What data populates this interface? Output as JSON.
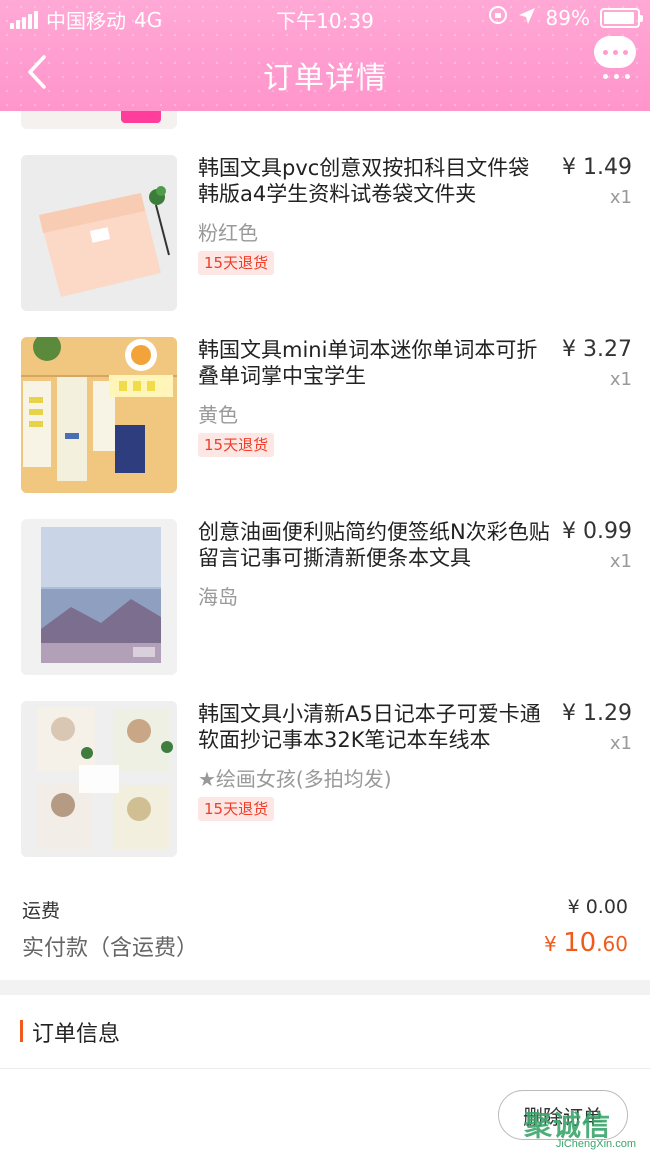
{
  "status_bar": {
    "carrier": "中国移动",
    "network": "4G",
    "time": "下午10:39",
    "battery": "89%"
  },
  "nav": {
    "title": "订单详情",
    "back_icon": "chevron-left-icon",
    "more_icon": "chat-more-icon"
  },
  "products": [
    {
      "name": "韩国文具pvc创意双按扣科目文件袋 韩版a4学生资料试卷袋文件夹",
      "spec": "粉红色",
      "tag": "15天退货",
      "price": "¥ 1.49",
      "qty": "x1"
    },
    {
      "name": "韩国文具mini单词本迷你单词本可折叠单词掌中宝学生",
      "spec": "黄色",
      "tag": "15天退货",
      "price": "¥ 3.27",
      "qty": "x1"
    },
    {
      "name": "创意油画便利贴简约便签纸N次彩色贴留言记事可撕清新便条本文具",
      "spec": "海岛",
      "tag": "",
      "price": "¥ 0.99",
      "qty": "x1"
    },
    {
      "name": "韩国文具小清新A5日记本子可爱卡通软面抄记事本32K笔记本车线本",
      "spec": "★绘画女孩(多拍均发)",
      "tag": "15天退货",
      "price": "¥ 1.29",
      "qty": "x1"
    }
  ],
  "totals": {
    "shipping_label": "运费",
    "shipping_value": "¥ 0.00",
    "paid_label": "实付款（含运费）",
    "paid_currency": "¥ ",
    "paid_integer": "10",
    "paid_decimal": ".60"
  },
  "order_info": {
    "heading": "订单信息"
  },
  "actions": {
    "delete_label": "删除订单"
  },
  "watermark": {
    "text": "聚诚信",
    "sub": "JiChengXin.com"
  },
  "colors": {
    "header_pink": "#ff9ccf",
    "accent_orange": "#f05a1a",
    "tag_red": "#f23c28"
  }
}
